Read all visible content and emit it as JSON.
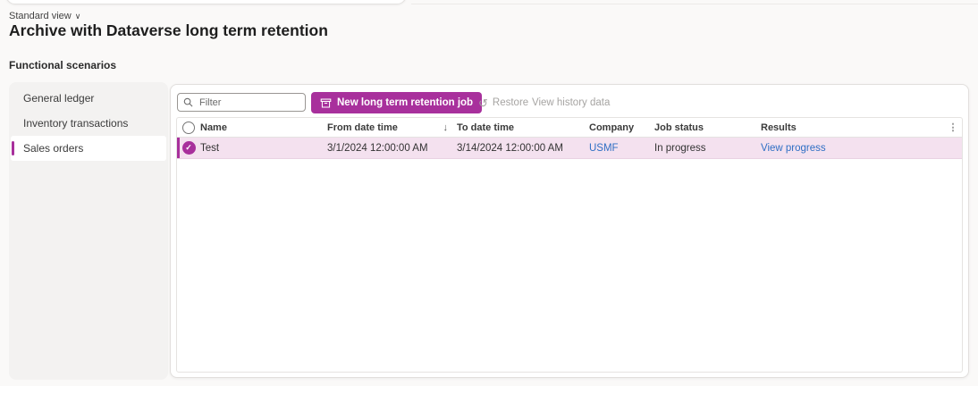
{
  "page": {
    "view_selector": "Standard view",
    "title": "Archive with Dataverse long term retention",
    "section_label": "Functional scenarios"
  },
  "sidebar": {
    "items": [
      {
        "label": "General ledger",
        "selected": false
      },
      {
        "label": "Inventory transactions",
        "selected": false
      },
      {
        "label": "Sales orders",
        "selected": true
      }
    ]
  },
  "toolbar": {
    "filter_placeholder": "Filter",
    "new_job_label": "New long term retention job",
    "restore_label": "Restore",
    "view_history_label": "View history data"
  },
  "table": {
    "columns": [
      "Name",
      "From date time",
      "To date time",
      "Company",
      "Job status",
      "Results"
    ],
    "sorted_column": "From date time",
    "sort_direction": "descending",
    "rows": [
      {
        "name": "Test",
        "from": "3/1/2024 12:00:00 AM",
        "to": "3/14/2024 12:00:00 AM",
        "company": "USMF",
        "status": "In progress",
        "results": "View progress",
        "selected": true
      }
    ]
  },
  "icons": {
    "chevron_down": "∨",
    "sort_descending": "↓",
    "more_options": "⋮",
    "restore": "↺",
    "check": "✓"
  },
  "colors": {
    "accent": "#A8309C",
    "row_highlight": "#F4E1EF",
    "link": "#2F6FC4",
    "disabled_text": "#A6A4A2",
    "sidebar_bg": "#F3F2F1",
    "page_bg": "#FAF9F8"
  }
}
